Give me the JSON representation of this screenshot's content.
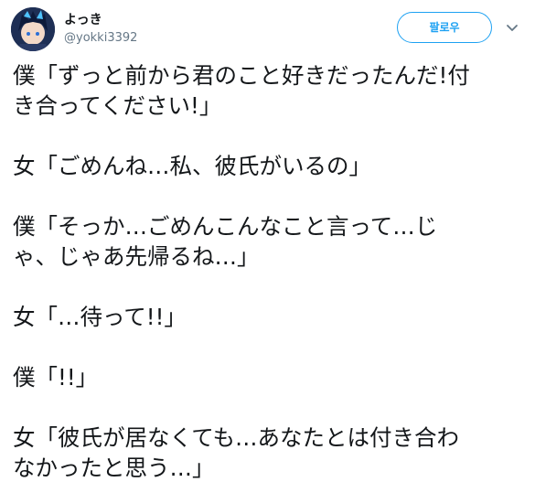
{
  "author": {
    "display_name": "よっき",
    "handle": "@yokki3392"
  },
  "follow_label": "팔로우",
  "icons": {
    "avatar": "anime-avatar",
    "menu": "chevron-down-icon"
  },
  "colors": {
    "accent": "#1da1f2",
    "text": "#14171a",
    "muted": "#657786"
  },
  "tweet_lines": [
    "僕「ずっと前から君のこと好きだったんだ!付",
    "き合ってください!」",
    "",
    "女「ごめんね…私、彼氏がいるの」",
    "",
    "僕「そっか…ごめんこんなこと言って…じ",
    "ゃ、じゃあ先帰るね…」",
    "",
    "女「…待って!!」",
    "",
    "僕「!!」",
    "",
    "女「彼氏が居なくても…あなたとは付き合わ",
    "なかったと思う…」"
  ]
}
